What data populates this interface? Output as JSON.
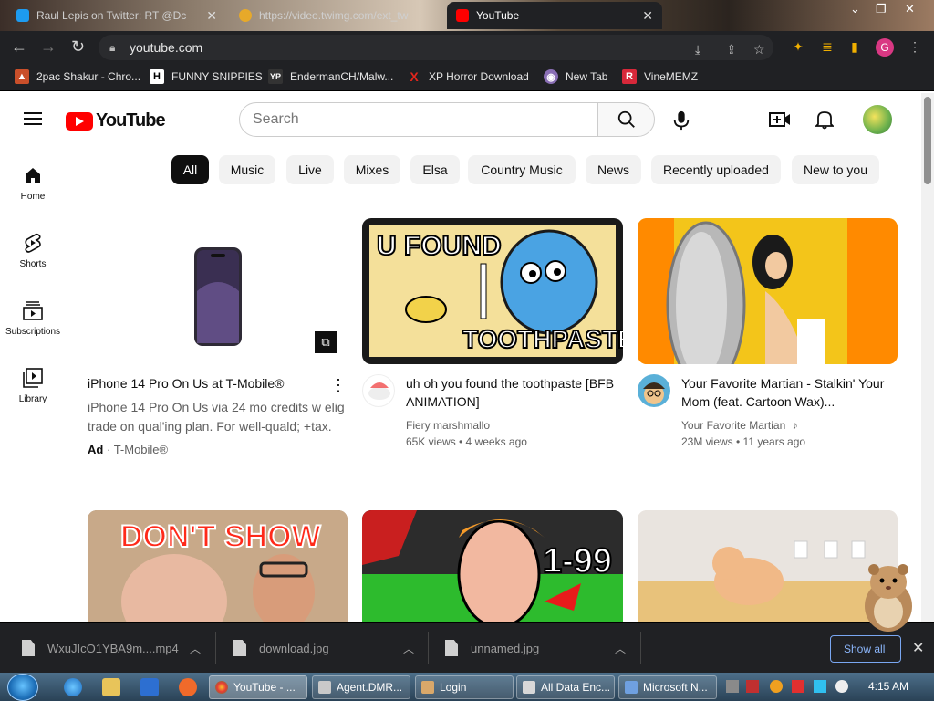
{
  "browser": {
    "tabs": [
      {
        "label": "Raul Lepis on Twitter: RT @Dc",
        "color": "#1d9bf0"
      },
      {
        "label": "https://video.twimg.com/ext_tw",
        "color": "#e7a92a"
      },
      {
        "label": "YouTube",
        "color": "#ff0000"
      }
    ],
    "url": "youtube.com",
    "bookmarks": [
      {
        "label": "2pac Shakur - Chro...",
        "icon": "H",
        "color": "#c94f2a"
      },
      {
        "label": "FUNNY SNIPPIES",
        "icon": "H",
        "color": "#ffffff"
      },
      {
        "label": "EndermanCH/Malw...",
        "icon": "YP",
        "color": "#333333"
      },
      {
        "label": "XP Horror Download",
        "icon": "X",
        "color": "#e3261c"
      },
      {
        "label": "New Tab",
        "icon": "◉",
        "color": "#8a6fb5"
      },
      {
        "label": "VineMEMZ",
        "icon": "R",
        "color": "#d7283a"
      }
    ],
    "profile_initial": "G"
  },
  "youtube": {
    "logo_text": "YouTube",
    "search_placeholder": "Search",
    "sidebar": [
      {
        "label": "Home",
        "icon": "home-icon"
      },
      {
        "label": "Shorts",
        "icon": "shorts-icon"
      },
      {
        "label": "Subscriptions",
        "icon": "subscriptions-icon"
      },
      {
        "label": "Library",
        "icon": "library-icon"
      }
    ],
    "chips": [
      "All",
      "Music",
      "Live",
      "Mixes",
      "Elsa",
      "Country Music",
      "News",
      "Recently uploaded",
      "New to you"
    ],
    "videos": [
      {
        "title": "iPhone 14 Pro On Us at T-Mobile®",
        "description": "iPhone 14 Pro On Us via 24 mo credits w elig trade on qual'ing plan. For well-quald; +tax.",
        "ad_label": "Ad",
        "advertiser": "T-Mobile®"
      },
      {
        "title": "uh oh you found the toothpaste [BFB ANIMATION]",
        "channel": "Fiery marshmallo",
        "stats": "65K views • 4 weeks ago",
        "thumb_text_top": "U FOUND",
        "thumb_text_bottom": "TOOTHPASTE"
      },
      {
        "title": "Your Favorite Martian - Stalkin' Your Mom (feat. Cartoon Wax)...",
        "channel": "Your Favorite Martian",
        "stats": "23M views • 11 years ago"
      }
    ],
    "row2": [
      {
        "thumb_text": "DON'T SHOW"
      },
      {
        "thumb_text": "1-99"
      },
      {
        "thumb_text": ""
      }
    ]
  },
  "downloads": {
    "items": [
      "WxuJIcO1YBA9m....mp4",
      "download.jpg",
      "unnamed.jpg"
    ],
    "show_all": "Show all"
  },
  "taskbar": {
    "tasks": [
      "YouTube - ...",
      "Agent.DMR...",
      "Login",
      "All Data Enc...",
      "Microsoft N..."
    ],
    "clock": "4:15 AM"
  }
}
